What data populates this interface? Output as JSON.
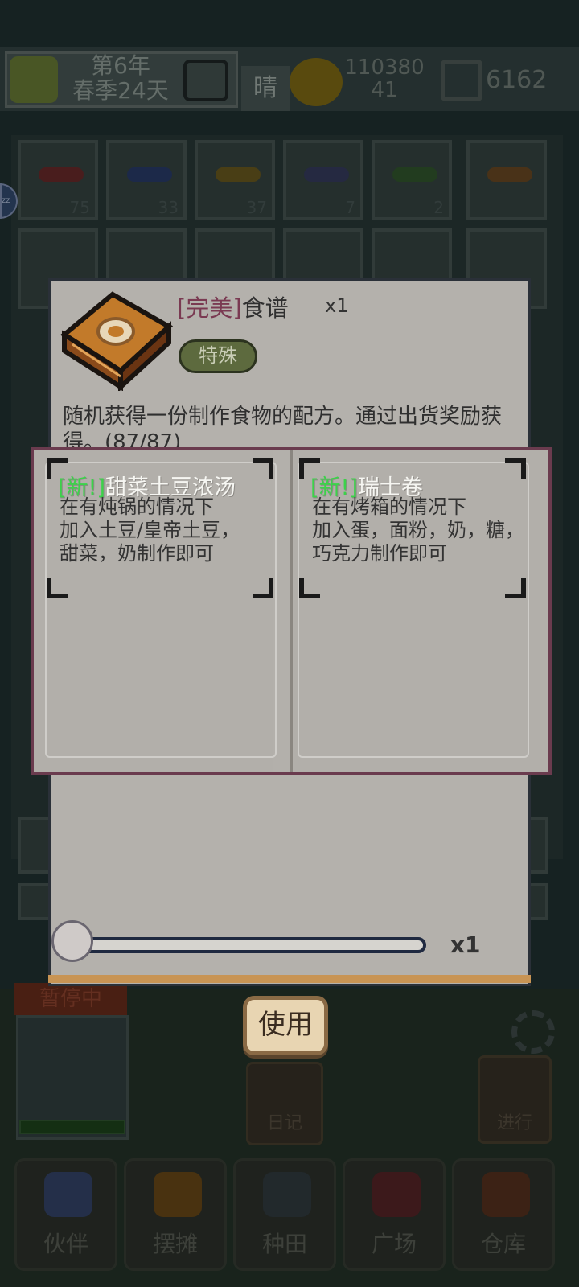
{
  "top_bar": {
    "date_line1": "第6年",
    "date_line2": "春季24天",
    "weather": "晴",
    "money_line1": "110380",
    "money_line2": "41",
    "gems": "6162"
  },
  "storage": {
    "row1": [
      {
        "count": "75",
        "color": "#5a2424"
      },
      {
        "count": "33",
        "color": "#23325a"
      },
      {
        "count": "37",
        "color": "#5a4c1a"
      },
      {
        "count": "7",
        "color": "#2e3250"
      },
      {
        "count": "2",
        "color": "#2a4a26"
      },
      {
        "count": "",
        "color": "#5a3e1e"
      }
    ],
    "side_badge": "zz"
  },
  "item": {
    "quality": "[完美]",
    "name": "食谱",
    "qty": "x1",
    "tag": "特殊",
    "description": "随机获得一份制作食物的配方。通过出货奖励获得。(87/87)"
  },
  "recipes": [
    {
      "new_tag": "[新!]",
      "name": "甜菜土豆浓汤",
      "lines": [
        "在有炖锅的情况下",
        "加入土豆/皇帝土豆，",
        "甜菜，奶制作即可"
      ]
    },
    {
      "new_tag": "[新!]",
      "name": "瑞士卷",
      "lines": [
        "在有烤箱的情况下",
        "加入蛋，面粉，奶，糖，",
        "巧克力制作即可"
      ]
    }
  ],
  "slider": {
    "quantity": "x1",
    "level": 0.0
  },
  "use_button": "使用",
  "status": {
    "paused": "暂停中"
  },
  "side_buttons": {
    "diary": "日记",
    "proceed": "进行"
  },
  "bottom_nav": [
    {
      "label": "伙伴",
      "icon": "partners-icon",
      "color": "#2c3a5a"
    },
    {
      "label": "摆摊",
      "icon": "stall-icon",
      "color": "#5a3e14"
    },
    {
      "label": "种田",
      "icon": "farming-icon",
      "color": "#2a3236"
    },
    {
      "label": "广场",
      "icon": "plaza-icon",
      "color": "#4a1f22"
    },
    {
      "label": "仓库",
      "icon": "warehouse-icon",
      "color": "#4a2a1a"
    }
  ]
}
